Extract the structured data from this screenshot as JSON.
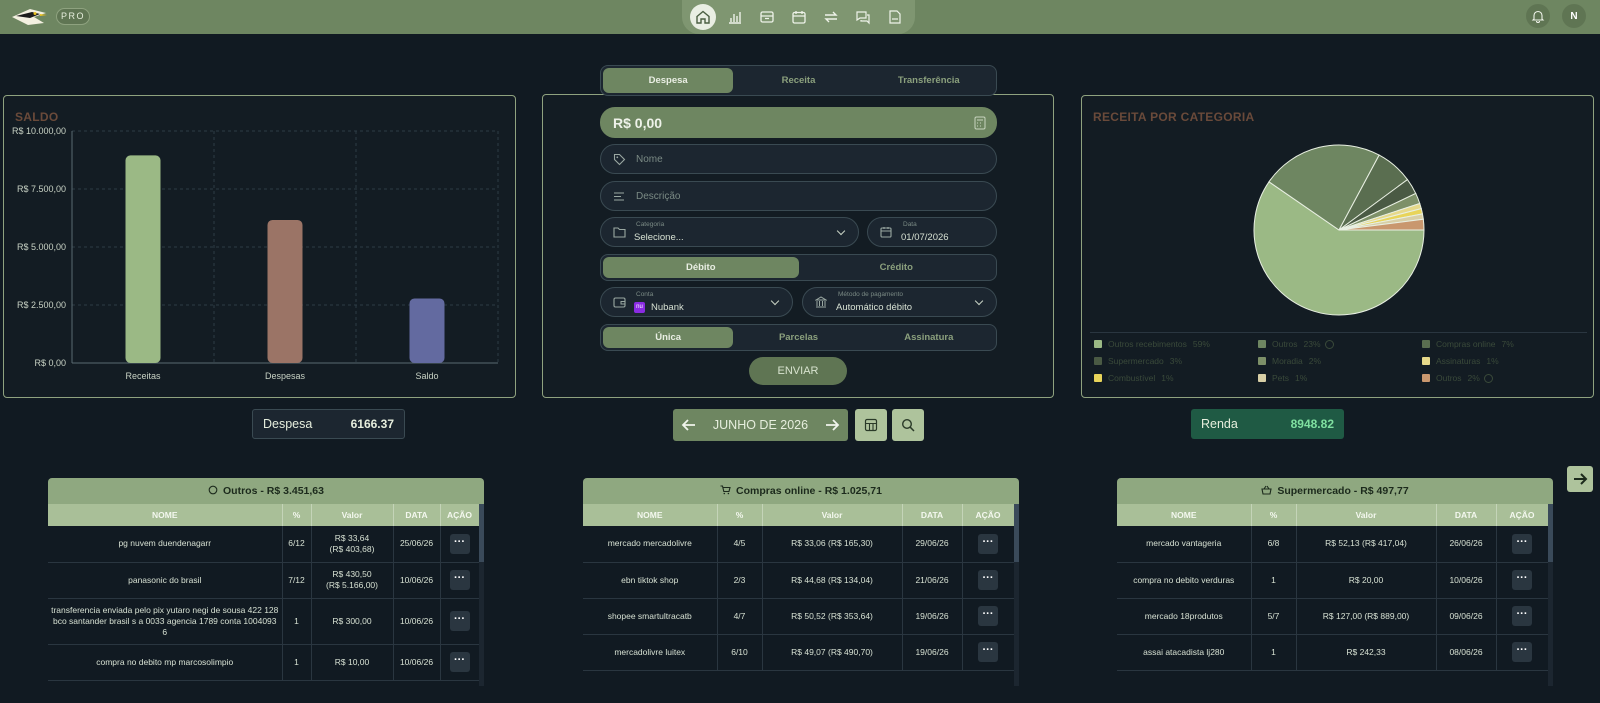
{
  "topbar": {
    "badge": "PRO",
    "nav_icons": [
      "home-icon",
      "bar-chart-icon",
      "archive-icon",
      "calendar-icon",
      "transfer-icon",
      "chat-icon",
      "export-file-icon"
    ],
    "user_initial": "N"
  },
  "saldo": {
    "title": "SALDO",
    "chart_data": {
      "type": "bar",
      "categories": [
        "Receitas",
        "Despesas",
        "Saldo"
      ],
      "values": [
        8948.82,
        6166.37,
        2782.45
      ],
      "colors": [
        "#9bb985",
        "#9b7466",
        "#636aa0"
      ],
      "ylim": [
        0,
        10000
      ],
      "ytick_values": [
        0,
        2500,
        5000,
        7500,
        10000
      ],
      "yticks": [
        "R$ 0,00",
        "R$ 2.500,00",
        "R$ 5.000,00",
        "R$ 7.500,00",
        "R$ 10.000,00"
      ],
      "grid": true
    }
  },
  "form": {
    "tabs": [
      "Despesa",
      "Receita",
      "Transferência"
    ],
    "amount": "R$ 0,00",
    "name_placeholder": "Nome",
    "desc_placeholder": "Descrição",
    "category_label": "Categoria",
    "category_value": "Selecione...",
    "date_label": "Data",
    "date_value": "01/07/2026",
    "debit_credit": [
      "Débito",
      "Crédito"
    ],
    "account_label": "Conta",
    "account_value": "Nubank",
    "account_badge": "nu",
    "method_label": "Método de pagamento",
    "method_value": "Automático débito",
    "recurrence": [
      "Única",
      "Parcelas",
      "Assinatura"
    ],
    "send": "ENVIAR"
  },
  "receita_categoria": {
    "title": "RECEITA POR CATEGORIA",
    "chart_data": {
      "type": "pie",
      "slices": [
        {
          "label": "Outros recebimentos",
          "value": 59,
          "color": "#9bb985"
        },
        {
          "label": "Outros",
          "value": 23,
          "color": "#6e8661"
        },
        {
          "label": "Compras online",
          "value": 7,
          "color": "#5a6e50"
        },
        {
          "label": "Supermercado",
          "value": 3,
          "color": "#4a5a44"
        },
        {
          "label": "Moradia",
          "value": 2,
          "color": "#7d9068"
        },
        {
          "label": "Assinaturas",
          "value": 1,
          "color": "#e6d98a"
        },
        {
          "label": "Combustível",
          "value": 1,
          "color": "#e8d45a"
        },
        {
          "label": "Pets",
          "value": 1,
          "color": "#d8cfa6"
        },
        {
          "label": "Outros",
          "value": 2,
          "color": "#c9976e"
        }
      ],
      "legend": [
        {
          "label": "Outros recebimentos",
          "pct": "59%",
          "color": "#9bb985"
        },
        {
          "label": "Outros",
          "pct": "23%",
          "color": "#6e8661",
          "info": true
        },
        {
          "label": "Compras online",
          "pct": "7%",
          "color": "#5a6e50"
        },
        {
          "label": "Supermercado",
          "pct": "3%",
          "color": "#4a5a44"
        },
        {
          "label": "Moradia",
          "pct": "2%",
          "color": "#7d9068"
        },
        {
          "label": "Assinaturas",
          "pct": "1%",
          "color": "#e6d98a"
        },
        {
          "label": "Combustível",
          "pct": "1%",
          "color": "#e8d45a"
        },
        {
          "label": "Pets",
          "pct": "1%",
          "color": "#d8cfa6"
        },
        {
          "label": "Outros",
          "pct": "2%",
          "color": "#c9976e",
          "info": true
        }
      ]
    }
  },
  "stats": {
    "despesa_label": "Despesa",
    "despesa_value": "6166.37",
    "renda_label": "Renda",
    "renda_value": "8948.82",
    "month": "JUNHO DE 2026"
  },
  "cards": [
    {
      "icon": "circle-icon",
      "title": "Outros - R$ 3.451,63",
      "headers": [
        "NOME",
        "%",
        "Valor",
        "DATA",
        "AÇÃO"
      ],
      "rows": [
        [
          "pg nuvem duendenagarr",
          "6/12",
          "R$ 33,64\n(R$ 403,68)",
          "25/06/26"
        ],
        [
          "panasonic do brasil",
          "7/12",
          "R$ 430,50\n(R$ 5.166,00)",
          "10/06/26"
        ],
        [
          "transferencia enviada pelo pix yutaro negi de sousa 422 128 bco santander brasil s a 0033 agencia 1789 conta 1004093 6",
          "1",
          "R$ 300,00",
          "10/06/26"
        ],
        [
          "compra no debito mp marcosolimpio",
          "1",
          "R$ 10,00",
          "10/06/26"
        ]
      ]
    },
    {
      "icon": "cart-icon",
      "title": "Compras online - R$ 1.025,71",
      "headers": [
        "NOME",
        "%",
        "Valor",
        "DATA",
        "AÇÃO"
      ],
      "rows": [
        [
          "mercado mercadolivre",
          "4/5",
          "R$ 33,06 (R$ 165,30)",
          "29/06/26"
        ],
        [
          "ebn tiktok shop",
          "2/3",
          "R$ 44,68 (R$ 134,04)",
          "21/06/26"
        ],
        [
          "shopee smartultracatb",
          "4/7",
          "R$ 50,52 (R$ 353,64)",
          "19/06/26"
        ],
        [
          "mercadolivre luitex",
          "6/10",
          "R$ 49,07 (R$ 490,70)",
          "19/06/26"
        ]
      ]
    },
    {
      "icon": "basket-icon",
      "title": "Supermercado - R$ 497,77",
      "headers": [
        "NOME",
        "%",
        "Valor",
        "DATA",
        "AÇÃO"
      ],
      "rows": [
        [
          "mercado vantageria",
          "6/8",
          "R$ 52,13 (R$ 417,04)",
          "26/06/26"
        ],
        [
          "compra no debito verduras",
          "1",
          "R$ 20,00",
          "10/06/26"
        ],
        [
          "mercado 18produtos",
          "5/7",
          "R$ 127,00 (R$ 889,00)",
          "09/06/26"
        ],
        [
          "assai atacadista lj280",
          "1",
          "R$ 242,33",
          "08/06/26"
        ]
      ]
    }
  ],
  "row_action": "···"
}
